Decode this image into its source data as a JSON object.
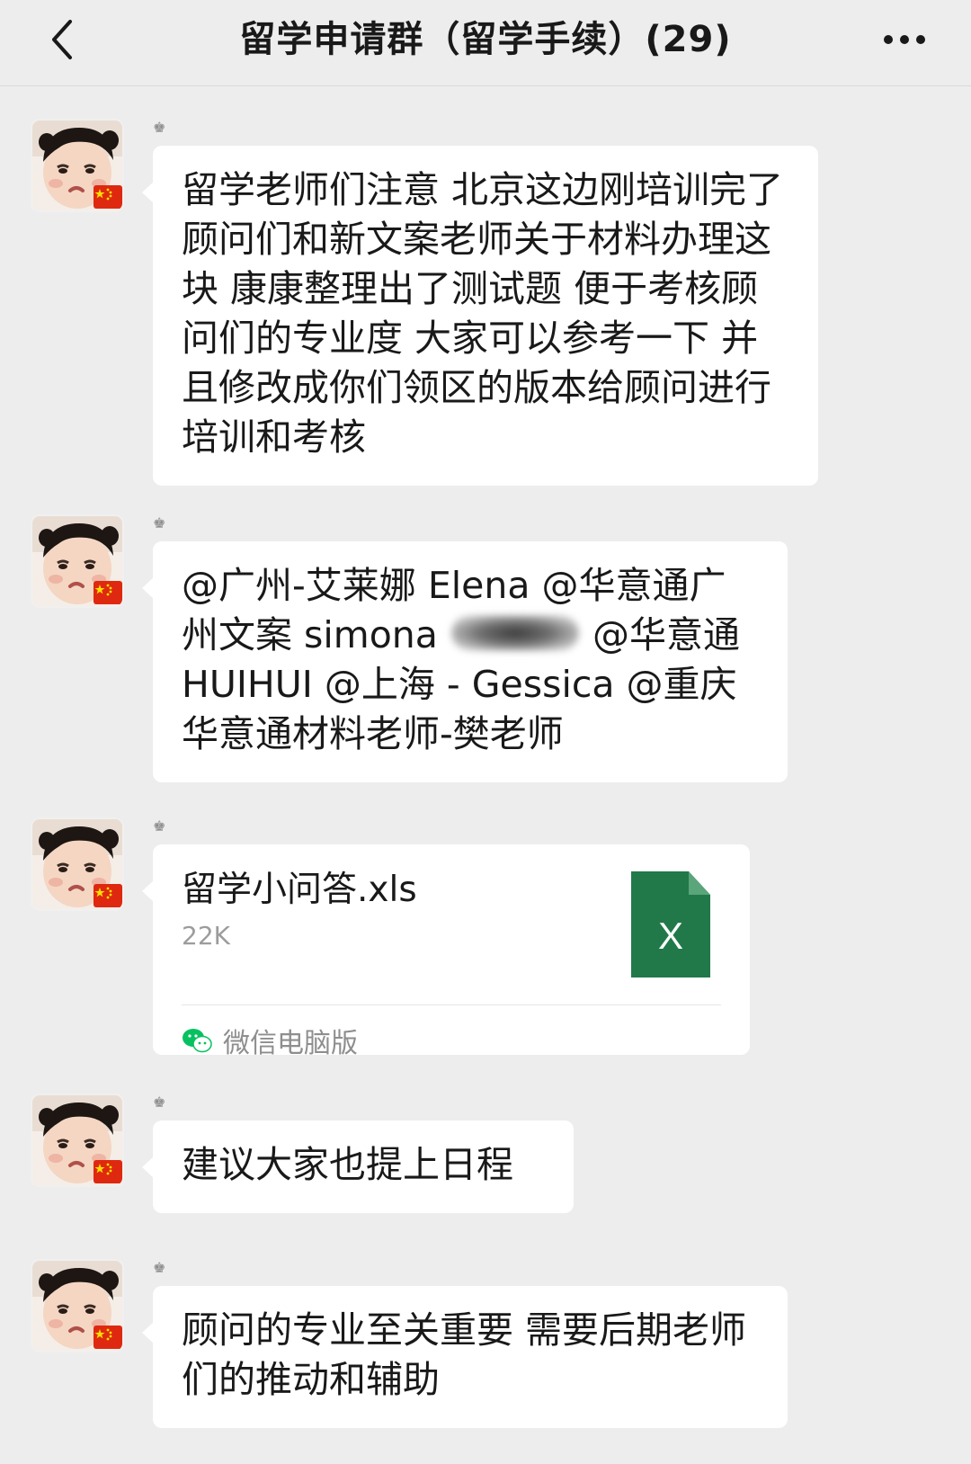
{
  "header": {
    "title": "留学申请群（留学手续）(29)",
    "back_icon": "chevron-left-icon",
    "more_icon": "ellipsis-icon"
  },
  "messages": [
    {
      "type": "text",
      "sender": "♚",
      "text": "留学老师们注意 北京这边刚培训完了顾问们和新文案老师关于材料办理这块 康康整理出了测试题 便于考核顾问们的专业度 大家可以参考一下 并且修改成你们领区的版本给顾问进行培训和考核"
    },
    {
      "type": "text",
      "sender": "♚",
      "text_before_blur": "@广州-艾莱娜 Elena @华意通广州文案 simona ",
      "text_after_blur": " @华意通 HUIHUI @上海 - Gessica @重庆华意通材料老师-樊老师"
    },
    {
      "type": "file",
      "sender": "♚",
      "file_name": "留学小问答.xls",
      "file_size": "22K",
      "file_icon_letter": "X",
      "source": "微信电脑版"
    },
    {
      "type": "text",
      "sender": "♚",
      "text": "建议大家也提上日程"
    },
    {
      "type": "text",
      "sender": "♚",
      "text": "顾问的专业至关重要 需要后期老师们的推动和辅助"
    }
  ],
  "colors": {
    "background": "#ededed",
    "bubble": "#ffffff",
    "excel_green": "#21794a",
    "wechat_green": "#07c160"
  }
}
